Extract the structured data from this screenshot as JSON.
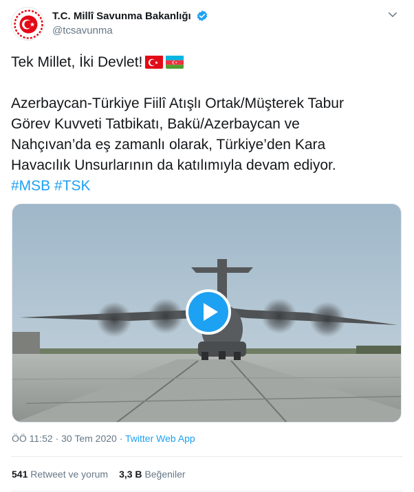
{
  "author": {
    "display_name": "T.C. Millî Savunma Bakanlığı",
    "handle": "@tcsavunma"
  },
  "tweet": {
    "headline": "Tek Millet, İki Devlet!",
    "flags": [
      "flag-turkey-icon",
      "flag-azerbaijan-icon"
    ],
    "body_lines": [
      "Azerbaycan-Türkiye Fiilî Atışlı Ortak/Müşterek Tabur",
      "Görev Kuvveti Tatbikatı, Bakü/Azerbaycan ve",
      "Nahçıvan’da eş zamanlı olarak, Türkiye’den Kara",
      "Havacılık Unsurlarının da katılımıyla devam ediyor."
    ],
    "hashtags": [
      "#MSB",
      "#TSK"
    ]
  },
  "media": {
    "type": "video",
    "play_icon": "play-icon"
  },
  "meta": {
    "time": "ÖÖ 11:52",
    "separator": "·",
    "date": "30 Tem 2020",
    "source": "Twitter Web App"
  },
  "stats": {
    "retweets_count": "541",
    "retweets_label": "Retweet ve yorum",
    "likes_count": "3,3 B",
    "likes_label": "Beğeniler"
  },
  "colors": {
    "accent": "#1da1f2",
    "text": "#14171a",
    "muted": "#657786",
    "logo_red": "#e30a17"
  }
}
